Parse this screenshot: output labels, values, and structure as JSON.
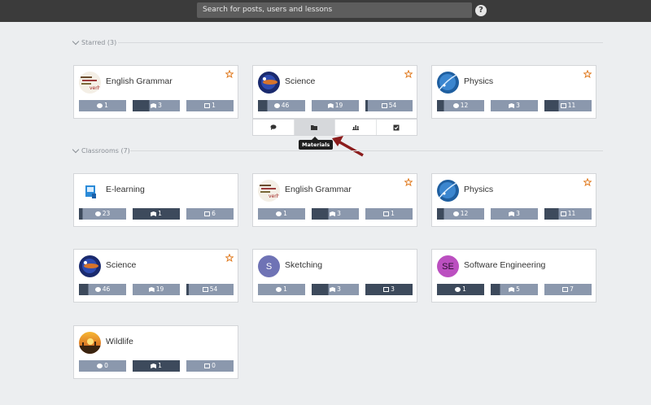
{
  "search": {
    "placeholder": "Search for posts, users and lessons"
  },
  "help_icon": "?",
  "colors": {
    "topbar": "#3b3b3b",
    "stat_light": "#8b98ad",
    "stat_dark": "#3d4a5c",
    "star": "#e07a1f",
    "arrow": "#8b1c1c"
  },
  "sections": {
    "starred": "Starred (3)",
    "classrooms": "Classrooms (7)"
  },
  "toolbar": {
    "tooltip": "Materials",
    "buttons": [
      "chat-icon",
      "folder-icon",
      "chart-icon",
      "check-icon"
    ]
  },
  "starred": [
    {
      "name": "English Grammar",
      "starred": true,
      "stats": [
        "1",
        "3",
        "1"
      ]
    },
    {
      "name": "Science",
      "starred": true,
      "stats": [
        "46",
        "19",
        "54"
      ]
    },
    {
      "name": "Physics",
      "starred": true,
      "stats": [
        "12",
        "3",
        "11"
      ]
    }
  ],
  "classrooms": [
    {
      "name": "E-learning",
      "starred": false,
      "stats": [
        "23",
        "1",
        "6"
      ]
    },
    {
      "name": "English Grammar",
      "starred": true,
      "stats": [
        "1",
        "3",
        "1"
      ]
    },
    {
      "name": "Physics",
      "starred": true,
      "stats": [
        "12",
        "3",
        "11"
      ]
    },
    {
      "name": "Science",
      "starred": true,
      "stats": [
        "46",
        "19",
        "54"
      ]
    },
    {
      "name": "Sketching",
      "avatar_text": "S",
      "starred": false,
      "stats": [
        "1",
        "3",
        "3"
      ]
    },
    {
      "name": "Software Engineering",
      "avatar_text": "SE",
      "starred": false,
      "stats": [
        "1",
        "5",
        "7"
      ]
    },
    {
      "name": "Wildlife",
      "starred": false,
      "stats": [
        "0",
        "1",
        "0"
      ]
    }
  ]
}
